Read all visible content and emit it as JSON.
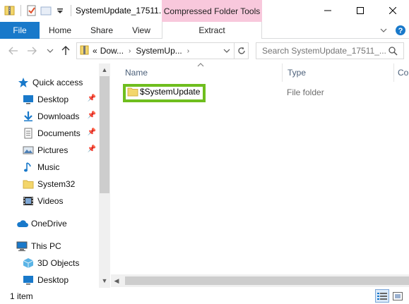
{
  "window": {
    "title": "SystemUpdate_17511...",
    "context_tab_title": "Compressed Folder Tools"
  },
  "ribbon": {
    "tabs": [
      "File",
      "Home",
      "Share",
      "View",
      "Extract"
    ]
  },
  "address": {
    "prefix": "«",
    "segments": [
      "Dow...",
      "SystemUp..."
    ]
  },
  "search": {
    "placeholder": "Search SystemUpdate_17511_..."
  },
  "nav_pane": {
    "quick_access": "Quick access",
    "items": [
      {
        "label": "Desktop",
        "icon": "desktop-icon",
        "pinned": true
      },
      {
        "label": "Downloads",
        "icon": "download-icon",
        "pinned": true
      },
      {
        "label": "Documents",
        "icon": "documents-icon",
        "pinned": true
      },
      {
        "label": "Pictures",
        "icon": "pictures-icon",
        "pinned": true
      },
      {
        "label": "Music",
        "icon": "music-icon",
        "pinned": false
      },
      {
        "label": "System32",
        "icon": "folder-icon",
        "pinned": false
      },
      {
        "label": "Videos",
        "icon": "videos-icon",
        "pinned": false
      }
    ],
    "onedrive": "OneDrive",
    "this_pc": "This PC",
    "pc_items": [
      {
        "label": "3D Objects",
        "icon": "3d-objects-icon"
      },
      {
        "label": "Desktop",
        "icon": "desktop-icon"
      }
    ]
  },
  "file_list": {
    "columns": [
      "Name",
      "Type",
      "Co"
    ],
    "rows": [
      {
        "name": "$SystemUpdate",
        "type": "File folder",
        "highlighted": true
      }
    ]
  },
  "status": {
    "item_count": "1 item"
  },
  "colors": {
    "file_tab": "#1979ca",
    "context_tab": "#f8c8dc",
    "highlight": "#6fbe1e",
    "folder": "#f3d66b"
  }
}
